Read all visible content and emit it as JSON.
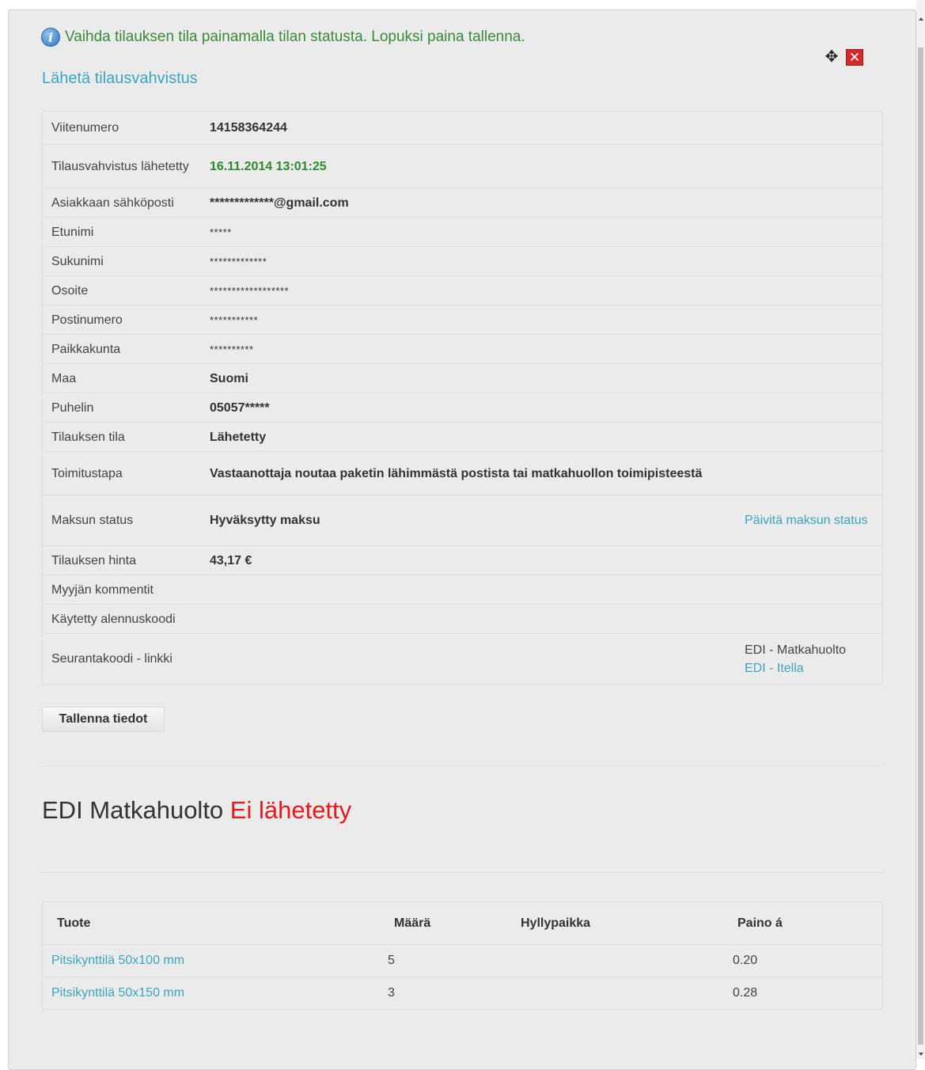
{
  "info": {
    "message": "Vaihda tilauksen tila painamalla tilan statusta. Lopuksi paina tallenna."
  },
  "send_confirmation_link": "Lähetä tilausvahvistus",
  "details": [
    {
      "label": "Viitenumero",
      "value": "14158364244"
    },
    {
      "label": "Tilausvahvistus lähetetty",
      "value": "16.11.2014 13:01:25"
    },
    {
      "label": "Asiakkaan sähköposti",
      "value": "*************@gmail.com"
    },
    {
      "label": "Etunimi",
      "value": "*****"
    },
    {
      "label": "Sukunimi",
      "value": "*************"
    },
    {
      "label": "Osoite",
      "value": "******************"
    },
    {
      "label": "Postinumero",
      "value": "***********"
    },
    {
      "label": "Paikkakunta",
      "value": "**********"
    },
    {
      "label": "Maa",
      "value": "Suomi"
    },
    {
      "label": "Puhelin",
      "value": "05057*****"
    },
    {
      "label": "Tilauksen tila",
      "value": "Lähetetty"
    },
    {
      "label": "Toimitustapa",
      "value": "Vastaanottaja noutaa paketin lähimmästä postista tai matkahuollon toimipisteestä"
    },
    {
      "label": "Maksun status",
      "value": "Hyväksytty maksu",
      "action": "Päivitä maksun status"
    },
    {
      "label": "Tilauksen hinta",
      "value": "43,17 €"
    },
    {
      "label": "Myyjän kommentit",
      "value": ""
    },
    {
      "label": "Käytetty alennuskoodi",
      "value": ""
    },
    {
      "label": "Seurantakoodi - linkki",
      "value": "",
      "action_text": "EDI - Matkahuolto",
      "action_link": "EDI - Itella"
    }
  ],
  "save_button": "Tallenna tiedot",
  "edi": {
    "title": "EDI Matkahuolto",
    "status": "Ei lähetetty"
  },
  "products": {
    "headers": [
      "Tuote",
      "Määrä",
      "Hyllypaikka",
      "Paino á"
    ],
    "rows": [
      {
        "name": "Pitsikynttilä 50x100 mm",
        "qty": "5",
        "shelf": "",
        "weight": "0.20"
      },
      {
        "name": "Pitsikynttilä 50x150 mm",
        "qty": "3",
        "shelf": "",
        "weight": "0.28"
      }
    ]
  },
  "colors": {
    "link": "#3aa6c2",
    "info_text": "#3a8a3a",
    "status_not_sent": "#e8191a",
    "date_green": "#2f8a2f"
  }
}
